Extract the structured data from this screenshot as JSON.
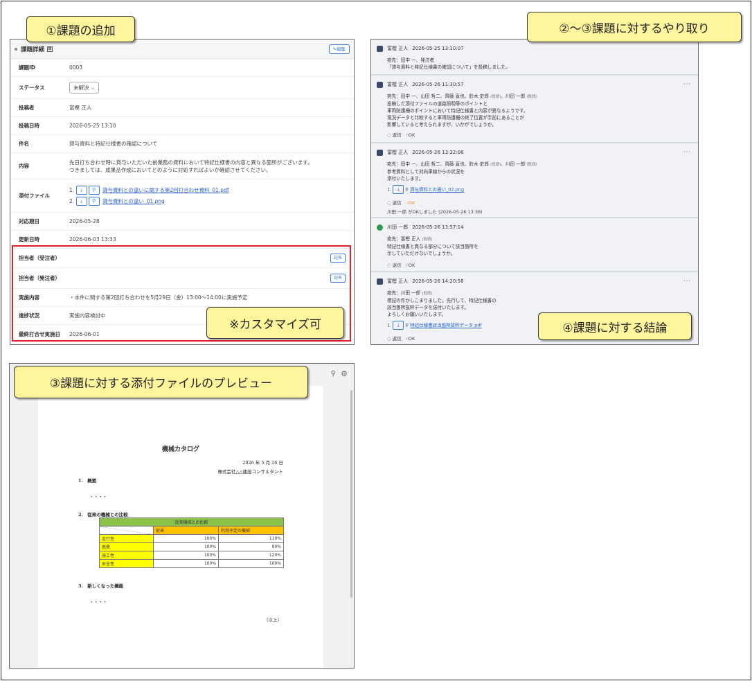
{
  "callouts": {
    "c1": "①課題の追加",
    "c2": "②～③課題に対するやり取り",
    "c3": "③課題に対する添付ファイルのプレビュー",
    "c4": "④課題に対する結論",
    "c5": "※カスタマイズ可"
  },
  "issue": {
    "header": "課題詳細",
    "header_badge": "⊞",
    "edit_label": "✎編集",
    "rows": {
      "id": {
        "label": "課題ID",
        "value": "0003"
      },
      "status": {
        "label": "ステータス",
        "value": "未解決 ⌵"
      },
      "poster": {
        "label": "投稿者",
        "value": "富樫 正人"
      },
      "posted_at": {
        "label": "投稿日時",
        "value": "2026-05-25 13:10"
      },
      "subject": {
        "label": "件名",
        "value": "貸与資料と特記仕様書の確認について"
      },
      "content": {
        "label": "内容",
        "line1": "先日打ち合わせ時に貸与いただいた前業務の資料において特記仕様書の内容と異なる箇所がございます。",
        "line2": "つきましては、成果品作成においてどのように対処すればよいか確認させてください。"
      },
      "attachments": {
        "label": "添付ファイル",
        "file1_no": "1.",
        "file1": "貸与資料との違いに関する第2回打合わせ資料_01.pdf",
        "file2_no": "2.",
        "file2": "貸与資料との違い_01.png"
      },
      "due": {
        "label": "対応期日",
        "value": "2026-05-28"
      },
      "updated": {
        "label": "更新日時",
        "value": "2026-06-03 13:33"
      },
      "assignee_contractor": {
        "label": "担当者（受注者）",
        "btn": "記名"
      },
      "assignee_client": {
        "label": "担当者（発注者）",
        "btn": "記名"
      },
      "plan": {
        "label": "実施内容",
        "value": "・本件に関する第2回打ち合わせを5月29日（金）13:00～14:00に実施予定"
      },
      "progress": {
        "label": "進捗状況",
        "value": "実施内容検討中"
      },
      "last_meeting": {
        "label": "最終打合せ実施日",
        "value": "2026-06-01"
      }
    },
    "icons": {
      "download": "⤓",
      "search": "🔍"
    }
  },
  "thread": {
    "m1": {
      "author": "富樫 正人",
      "time": "2026-05-25 13:10:07",
      "l1": "宛先：田中 一、発注者",
      "l2": "「貸与資料と特記仕様書の確認について」を投稿しました。"
    },
    "m2": {
      "author": "富樫 正人",
      "time": "2026-05-26 11:30:57",
      "l1": "宛先：田中 一、山田 哲二、齊藤 直也、鈴木 史郎",
      "l1_tag": "(既読)",
      "l1_b": "、川田 一郎",
      "l1_tag2": "(既読)",
      "l2": "投稿した添付ファイルの道路照明等のポイントと",
      "l3": "車両防護柵のポイントにおいて特記仕様書と内容が異なるようです。",
      "l4": "現況データと比較すると車両防護柵の終了位置が手前にあることが",
      "l5": "影響していると考えられますが、いかがでしょうか。",
      "reply": "返信",
      "ok": "OK"
    },
    "m3": {
      "author": "富樫 正人",
      "time": "2026-05-26 13:32:06",
      "l1": "宛先：田中 一、山田 哲二、齊藤 直也、鈴木 史郎",
      "l1_tag": "(既読)",
      "l1_b": "、川田 一郎",
      "l1_tag2": "(既読)",
      "l2": "参考資料として対向車線からの状況を",
      "l3": "添付いたします。",
      "file_no": "1.",
      "file": "貸与資料との違い_02.png",
      "reply": "返信",
      "ok": "OK",
      "ok_note": "川田 一郎 がOKしました (2026-05-26 13:38)"
    },
    "m4": {
      "author": "川田 一郎",
      "time": "2026-05-26 13:57:14",
      "l1": "宛先：富樫 正人",
      "l1_tag": "(既読)",
      "l2": "特記仕様書と異なる部分について該当箇所を",
      "l3": "示していただけないでしょうか。",
      "reply": "返信",
      "ok": "OK"
    },
    "m5": {
      "author": "富樫 正人",
      "time": "2026-05-26 14:20:58",
      "l1": "宛先：川田 一郎",
      "l1_tag": "(既読)",
      "l2": "標記の件かしこまりました。先行して、特記仕様書の",
      "l3": "該当箇所抜粋データを送付いたします。",
      "l4": "よろしくお願いいたします。",
      "file_no": "1.",
      "file": "特記仕様書該当箇所抜粋データ.pdf",
      "reply": "返信",
      "ok": "OK"
    },
    "dots": "···",
    "reply_icon": "💬",
    "ok_icon": "👍"
  },
  "preview": {
    "title": "機械カタログ",
    "date": "2026 年 5 月 26 日",
    "company": "株式会社△△建設コンサルタント",
    "s1": "1.　概要",
    "s1_body": "・・・・",
    "s2": "2.　従来の機械との比較",
    "table_header": "従来機械との比較",
    "col1": "従来",
    "col2": "利用予定の機械",
    "rows": [
      {
        "name": "走行性",
        "a": "100%",
        "b": "110%"
      },
      {
        "name": "燃費",
        "a": "100%",
        "b": "90%"
      },
      {
        "name": "施工性",
        "a": "100%",
        "b": "120%"
      },
      {
        "name": "安全性",
        "a": "100%",
        "b": "100%"
      }
    ],
    "s3": "3.　新しくなった機能",
    "s3_body": "・・・・",
    "end": "（以上）",
    "toolbar_search": "🔍",
    "toolbar_gear": "⚙"
  },
  "colors": {
    "accent": "#3a7bd5",
    "callout": "#fff59d",
    "highlight": "#e0202a",
    "table_green": "#8bc34a",
    "table_orange": "#ffc000",
    "table_yellow": "#ffff00"
  }
}
